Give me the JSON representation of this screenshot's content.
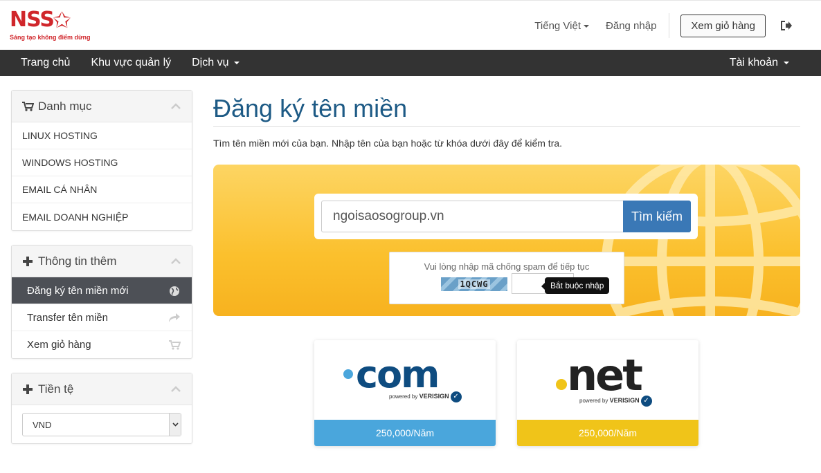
{
  "brand": {
    "name": "NSS",
    "tagline": "Sáng tạo không điểm dừng"
  },
  "top_nav": {
    "language": "Tiếng Việt",
    "login": "Đăng nhập",
    "cart_button": "Xem giỏ hàng"
  },
  "main_nav": {
    "items": [
      "Trang chủ",
      "Khu vực quản lý",
      "Dịch vụ"
    ],
    "account": "Tài khoản"
  },
  "sidebar": {
    "categories": {
      "title": "Danh mục",
      "items": [
        "LINUX HOSTING",
        "WINDOWS HOSTING",
        "EMAIL CÁ NHÂN",
        "EMAIL DOANH NGHIỆP"
      ]
    },
    "more_info": {
      "title": "Thông tin thêm",
      "items": [
        "Đăng ký tên miền mới",
        "Transfer tên miền",
        "Xem giỏ hàng"
      ]
    },
    "currency": {
      "title": "Tiền tệ",
      "selected": "VND"
    }
  },
  "main": {
    "title": "Đăng ký tên miền",
    "intro": "Tìm tên miền mới của bạn. Nhập tên của bạn hoặc từ khóa dưới đây để kiểm tra.",
    "search": {
      "value": "ngoisaosogroup.vn",
      "button": "Tìm kiếm"
    },
    "captcha": {
      "prompt": "Vui lòng nhập mã chống spam để tiếp tục",
      "code": "1QCWG",
      "tooltip": "Bắt buộc nhập"
    },
    "tlds": [
      {
        "name": ".com",
        "powered": "powered by",
        "vendor": "VERISIGN",
        "price": "250,000/Năm",
        "color": "#4aa6dc"
      },
      {
        "name": ".net",
        "powered": "powered by",
        "vendor": "VERISIGN",
        "price": "250,000/Năm",
        "color": "#f0c419"
      }
    ]
  },
  "colors": {
    "accent": "#1d5a85",
    "brand": "#d0262b",
    "nav": "#333333",
    "banner": "#fbc02d",
    "button": "#3a78b6"
  }
}
